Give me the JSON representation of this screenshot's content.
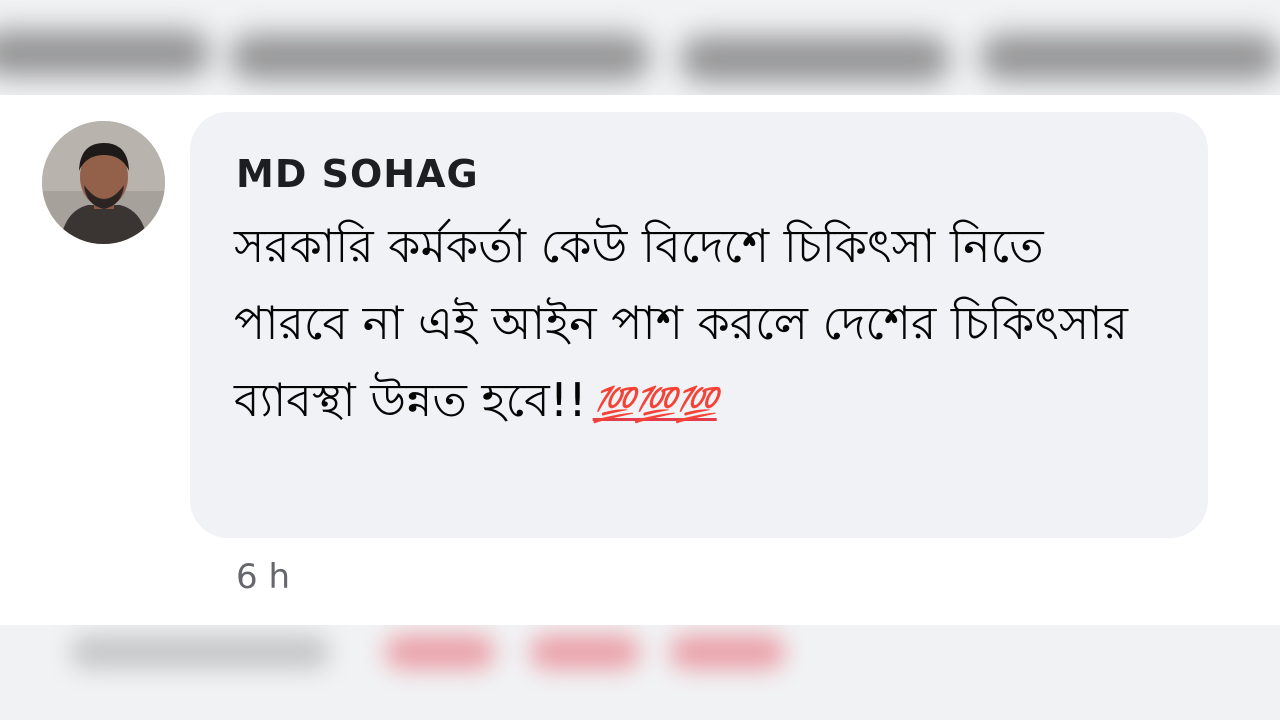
{
  "comment": {
    "author": "MD SOHAG",
    "text": "সরকারি কর্মকর্তা কেউ বিদেশে চিকিৎসা নিতে পারবে না এই আইন পাশ করলে দেশের চিকিৎসার ব্যাবস্থা উন্নত হবে!!",
    "emoji": "💯💯💯",
    "timestamp": "6 h"
  },
  "colors": {
    "bubble": "#f0f2f5",
    "author": "#1c1e21",
    "text": "#050505",
    "timestamp": "#65676b",
    "emoji_red": "#e23c4b"
  }
}
